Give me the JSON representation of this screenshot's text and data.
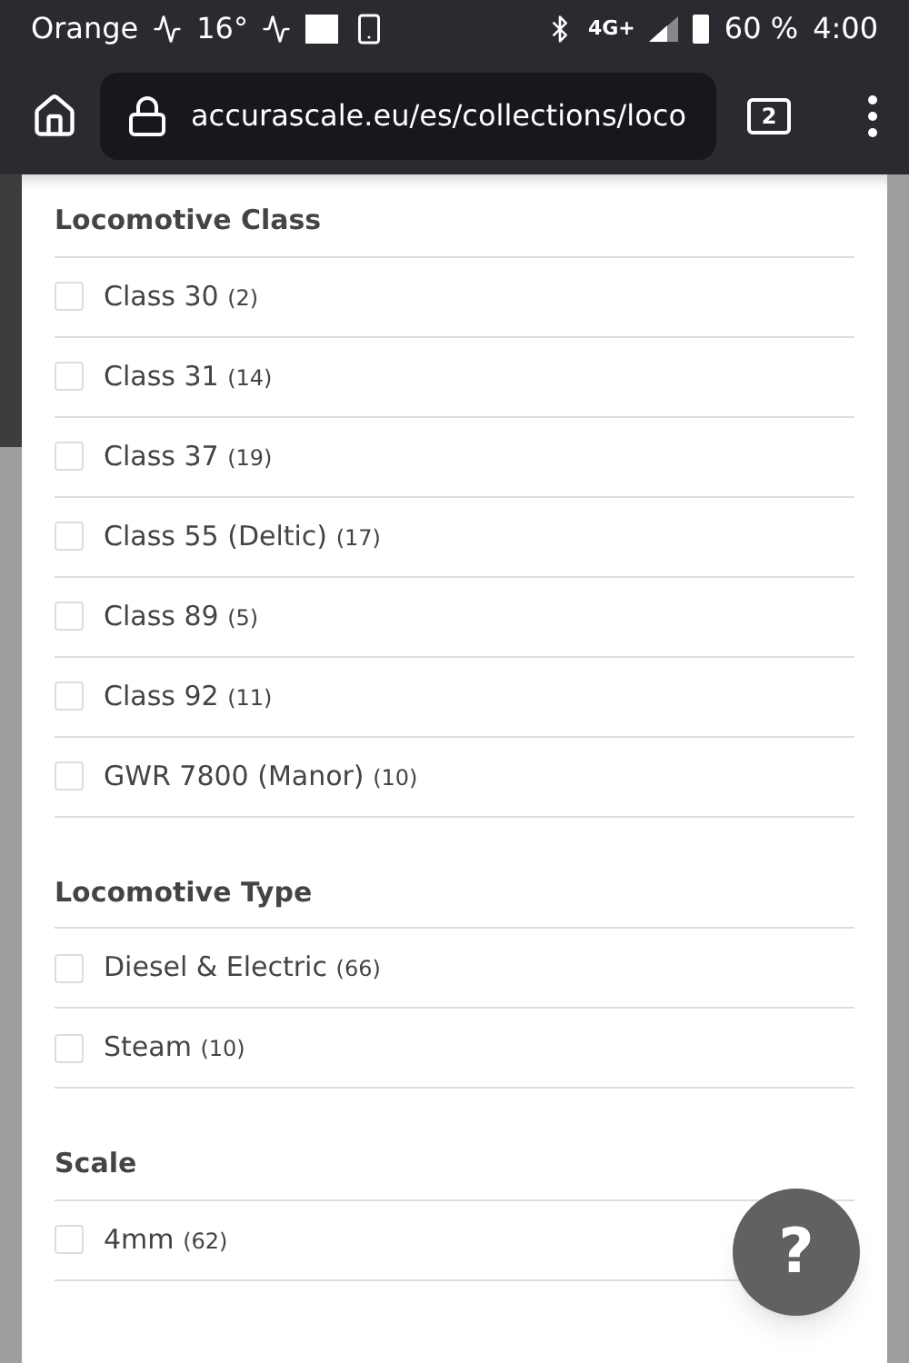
{
  "status_bar": {
    "carrier": "Orange",
    "temperature": "16°",
    "network": "4G+",
    "battery": "60 %",
    "time": "4:00"
  },
  "browser": {
    "url": "accurascale.eu/es/collections/loco",
    "tab_count": "2"
  },
  "filters": [
    {
      "title": "Locomotive Class",
      "items": [
        {
          "label": "Class 30",
          "count": "(2)",
          "checked": false
        },
        {
          "label": "Class 31",
          "count": "(14)",
          "checked": false
        },
        {
          "label": "Class 37",
          "count": "(19)",
          "checked": false
        },
        {
          "label": "Class 55 (Deltic)",
          "count": "(17)",
          "checked": false
        },
        {
          "label": "Class 89",
          "count": "(5)",
          "checked": false
        },
        {
          "label": "Class 92",
          "count": "(11)",
          "checked": false
        },
        {
          "label": "GWR 7800 (Manor)",
          "count": "(10)",
          "checked": false
        }
      ]
    },
    {
      "title": "Locomotive Type",
      "items": [
        {
          "label": "Diesel & Electric",
          "count": "(66)",
          "checked": false
        },
        {
          "label": "Steam",
          "count": "(10)",
          "checked": false
        }
      ]
    },
    {
      "title": "Scale",
      "items": [
        {
          "label": "4mm",
          "count": "(62)",
          "checked": false
        }
      ]
    }
  ],
  "help_button": {
    "label": "?"
  }
}
